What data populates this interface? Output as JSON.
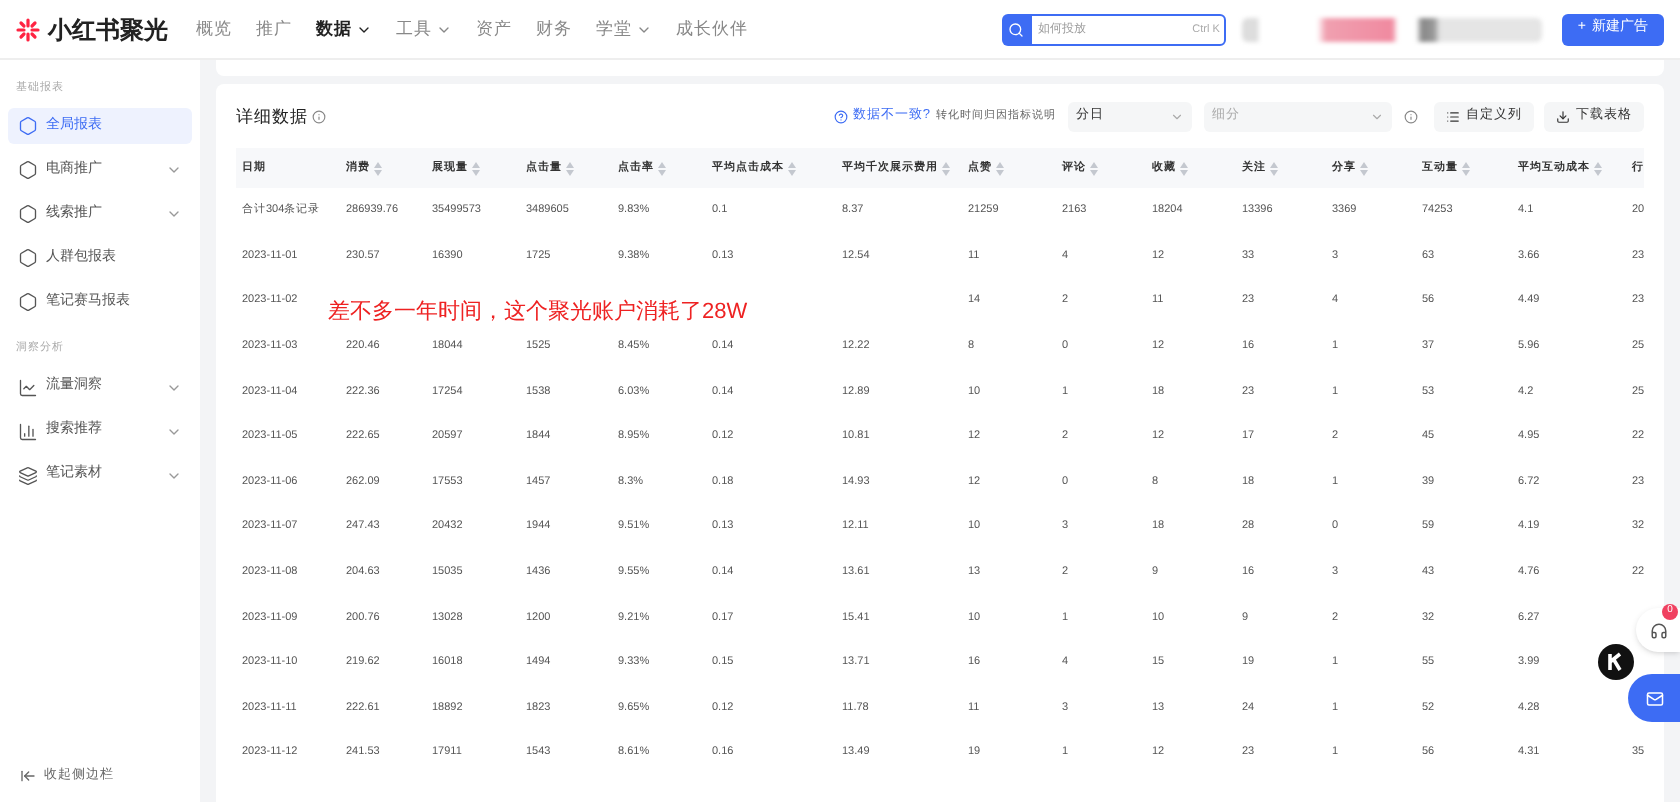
{
  "brand": {
    "name": "小红书聚光"
  },
  "nav": [
    {
      "label": "概览",
      "selected": false,
      "dropdown": false
    },
    {
      "label": "推广",
      "selected": false,
      "dropdown": false
    },
    {
      "label": "数据",
      "selected": true,
      "dropdown": true
    },
    {
      "label": "工具",
      "selected": false,
      "dropdown": true
    },
    {
      "label": "资产",
      "selected": false,
      "dropdown": false
    },
    {
      "label": "财务",
      "selected": false,
      "dropdown": false
    },
    {
      "label": "学堂",
      "selected": false,
      "dropdown": true
    },
    {
      "label": "成长伙伴",
      "selected": false,
      "dropdown": false
    }
  ],
  "search": {
    "placeholder": "如何投放",
    "shortcut": "Ctrl K"
  },
  "new_ad_button": {
    "icon": "+",
    "label": "新建广告"
  },
  "sidebar": {
    "sections": [
      {
        "title": "基础报表",
        "items": [
          {
            "label": "全局报表",
            "selected": true,
            "expandable": false,
            "kind": "report"
          },
          {
            "label": "电商推广",
            "selected": false,
            "expandable": true,
            "kind": "report"
          },
          {
            "label": "线索推广",
            "selected": false,
            "expandable": true,
            "kind": "report"
          },
          {
            "label": "人群包报表",
            "selected": false,
            "expandable": false,
            "kind": "report"
          },
          {
            "label": "笔记赛马报表",
            "selected": false,
            "expandable": false,
            "kind": "report"
          }
        ]
      },
      {
        "title": "洞察分析",
        "items": [
          {
            "label": "流量洞察",
            "selected": false,
            "expandable": true,
            "kind": "trend"
          },
          {
            "label": "搜索推荐",
            "selected": false,
            "expandable": true,
            "kind": "bars"
          },
          {
            "label": "笔记素材",
            "selected": false,
            "expandable": true,
            "kind": "material"
          }
        ]
      }
    ],
    "collapse": "收起侧边栏"
  },
  "card": {
    "title": "详细数据",
    "mismatch_link": "数据不一致?",
    "attribution_note": "转化时间归因指标说明",
    "granularity": "分日",
    "breakdown_placeholder": "细分",
    "custom_columns": "自定义列",
    "download": "下载表格"
  },
  "table": {
    "columns": [
      {
        "label": "日期",
        "sortable": false
      },
      {
        "label": "消费",
        "sortable": true
      },
      {
        "label": "展现量",
        "sortable": true
      },
      {
        "label": "点击量",
        "sortable": true
      },
      {
        "label": "点击率",
        "sortable": true
      },
      {
        "label": "平均点击成本",
        "sortable": true
      },
      {
        "label": "平均千次展示费用",
        "sortable": true
      },
      {
        "label": "点赞",
        "sortable": true
      },
      {
        "label": "评论",
        "sortable": true
      },
      {
        "label": "收藏",
        "sortable": true
      },
      {
        "label": "关注",
        "sortable": true
      },
      {
        "label": "分享",
        "sortable": true
      },
      {
        "label": "互动量",
        "sortable": true
      },
      {
        "label": "平均互动成本",
        "sortable": true
      },
      {
        "label": "行",
        "sortable": false
      }
    ],
    "rows": [
      [
        "合计304条记录",
        "286939.76",
        "35499573",
        "3489605",
        "9.83%",
        "0.1",
        "8.37",
        "21259",
        "2163",
        "18204",
        "13396",
        "3369",
        "74253",
        "4.1",
        "20"
      ],
      [
        "2023-11-01",
        "230.57",
        "16390",
        "1725",
        "9.38%",
        "0.13",
        "12.54",
        "11",
        "4",
        "12",
        "33",
        "3",
        "63",
        "3.66",
        "23"
      ],
      [
        "2023-11-02",
        null,
        null,
        null,
        null,
        null,
        null,
        "14",
        "2",
        "11",
        "23",
        "4",
        "56",
        "4.49",
        "23"
      ],
      [
        "2023-11-03",
        "220.46",
        "18044",
        "1525",
        "8.45%",
        "0.14",
        "12.22",
        "8",
        "0",
        "12",
        "16",
        "1",
        "37",
        "5.96",
        "25"
      ],
      [
        "2023-11-04",
        "222.36",
        "17254",
        "1538",
        "6.03%",
        "0.14",
        "12.89",
        "10",
        "1",
        "18",
        "23",
        "1",
        "53",
        "4.2",
        "25"
      ],
      [
        "2023-11-05",
        "222.65",
        "20597",
        "1844",
        "8.95%",
        "0.12",
        "10.81",
        "12",
        "2",
        "12",
        "17",
        "2",
        "45",
        "4.95",
        "22"
      ],
      [
        "2023-11-06",
        "262.09",
        "17553",
        "1457",
        "8.3%",
        "0.18",
        "14.93",
        "12",
        "0",
        "8",
        "18",
        "1",
        "39",
        "6.72",
        "23"
      ],
      [
        "2023-11-07",
        "247.43",
        "20432",
        "1944",
        "9.51%",
        "0.13",
        "12.11",
        "10",
        "3",
        "18",
        "28",
        "0",
        "59",
        "4.19",
        "32"
      ],
      [
        "2023-11-08",
        "204.63",
        "15035",
        "1436",
        "9.55%",
        "0.14",
        "13.61",
        "13",
        "2",
        "9",
        "16",
        "3",
        "43",
        "4.76",
        "22"
      ],
      [
        "2023-11-09",
        "200.76",
        "13028",
        "1200",
        "9.21%",
        "0.17",
        "15.41",
        "10",
        "1",
        "10",
        "9",
        "2",
        "32",
        "6.27",
        null
      ],
      [
        "2023-11-10",
        "219.62",
        "16018",
        "1494",
        "9.33%",
        "0.15",
        "13.71",
        "16",
        "4",
        "15",
        "19",
        "1",
        "55",
        "3.99",
        null
      ],
      [
        "2023-11-11",
        "222.61",
        "18892",
        "1823",
        "9.65%",
        "0.12",
        "11.78",
        "11",
        "3",
        "13",
        "24",
        "1",
        "52",
        "4.28",
        null
      ],
      [
        "2023-11-12",
        "241.53",
        "17911",
        "1543",
        "8.61%",
        "0.16",
        "13.49",
        "19",
        "1",
        "12",
        "23",
        "1",
        "56",
        "4.31",
        "35"
      ]
    ]
  },
  "overlay_caption": "差不多一年时间，这个聚光账户消耗了28W",
  "support_badge": "0"
}
